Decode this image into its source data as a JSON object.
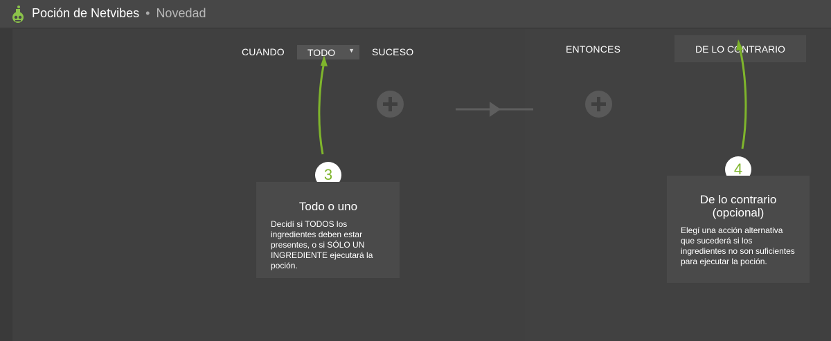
{
  "header": {
    "app_name": "Poción de Netvibes",
    "separator": "•",
    "subtitle": "Novedad"
  },
  "rule": {
    "when_label": "CUANDO",
    "match_value": "TODO",
    "event_label": "SUCESO",
    "then_label": "ENTONCES",
    "else_label": "DE LO CONTRARIO"
  },
  "callouts": [
    {
      "number": "3",
      "title": "Todo o uno",
      "text": "Decidí si TODOS los ingredientes deben estar presentes, o si SÓLO UN INGREDIENTE ejecutará la poción."
    },
    {
      "number": "4",
      "title": "De lo contrario (opcional)",
      "text": "Elegí una acción alternativa que sucederá si los ingredientes no son suficientes para ejecutar la poción."
    }
  ],
  "colors": {
    "accent": "#7fb52c",
    "background": "#3e3e3e",
    "topbar": "#474747"
  }
}
